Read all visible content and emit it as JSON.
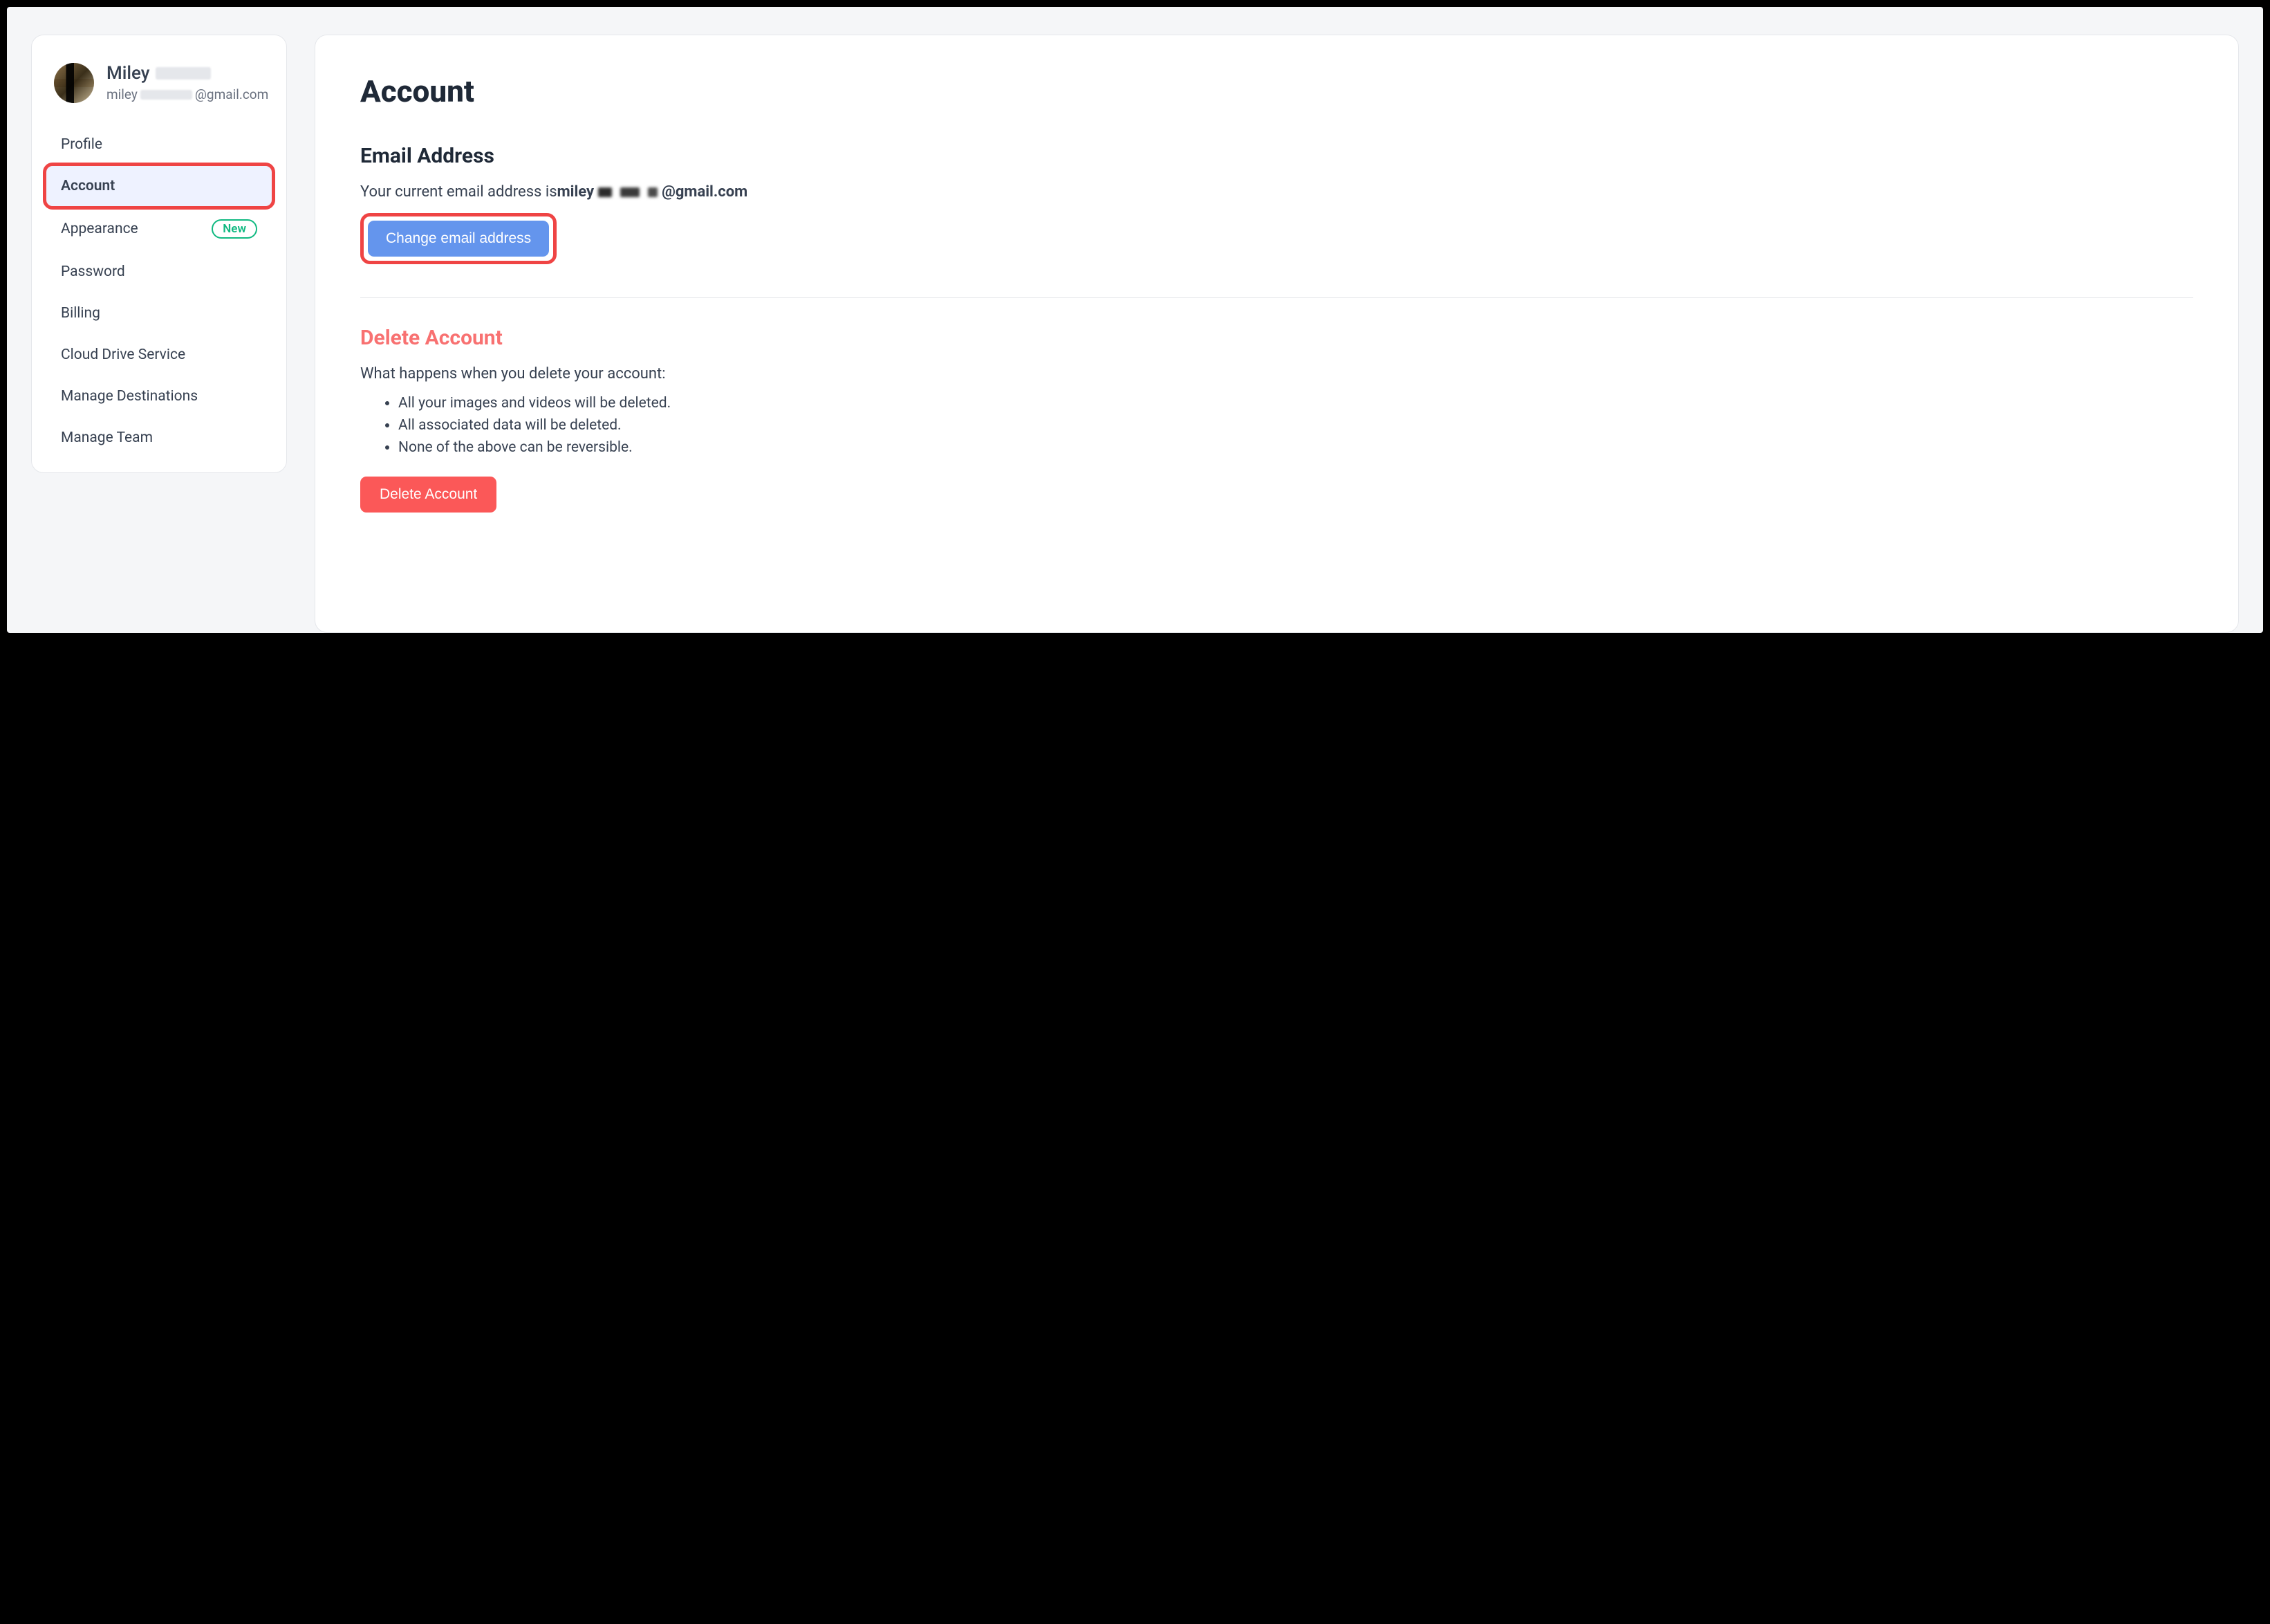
{
  "sidebar": {
    "user": {
      "name_visible": "Miley",
      "email_prefix": "miley",
      "email_suffix": "@gmail.com"
    },
    "items": [
      {
        "label": "Profile",
        "active": false,
        "badge": null
      },
      {
        "label": "Account",
        "active": true,
        "badge": null
      },
      {
        "label": "Appearance",
        "active": false,
        "badge": "New"
      },
      {
        "label": "Password",
        "active": false,
        "badge": null
      },
      {
        "label": "Billing",
        "active": false,
        "badge": null
      },
      {
        "label": "Cloud Drive Service",
        "active": false,
        "badge": null
      },
      {
        "label": "Manage Destinations",
        "active": false,
        "badge": null
      },
      {
        "label": "Manage Team",
        "active": false,
        "badge": null
      }
    ]
  },
  "main": {
    "title": "Account",
    "email_section": {
      "heading": "Email Address",
      "body_prefix": "Your current email address is ",
      "current_email_prefix": "miley",
      "current_email_suffix": "@gmail.com",
      "change_button": "Change email address"
    },
    "delete_section": {
      "heading": "Delete Account",
      "intro": "What happens when you delete your account:",
      "bullets": [
        "All your images and videos will be deleted.",
        "All associated data will be deleted.",
        "None of the above can be reversible."
      ],
      "delete_button": "Delete Account"
    }
  }
}
